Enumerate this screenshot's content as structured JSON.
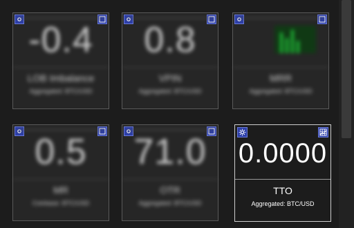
{
  "tiles": [
    {
      "value": "-0.4",
      "title": "LOB Imbalance",
      "subtitle": "Aggregated: BTC/USD"
    },
    {
      "value": "0.8",
      "title": "VPIN",
      "subtitle": "Aggregated: BTC/USD"
    },
    {
      "value": "",
      "title": "MRR",
      "subtitle": "Aggregated: BTC/USD"
    },
    {
      "value": "0.5",
      "title": "MR",
      "subtitle": "Coinbase: BTC/USD"
    },
    {
      "value": "71.0",
      "title": "OTR",
      "subtitle": "Aggregated: BTC/USD"
    },
    {
      "value": "0.0000",
      "title": "TTO",
      "subtitle": "Aggregated: BTC/USD"
    }
  ],
  "icons": {
    "left": "settings-icon",
    "right": "chart-grid-icon"
  },
  "colors": {
    "background": "#1c1c1c",
    "tile_border": "#5a5a5a",
    "icon_button": "#2d3fa8",
    "sparkline": "#1ed33a"
  }
}
